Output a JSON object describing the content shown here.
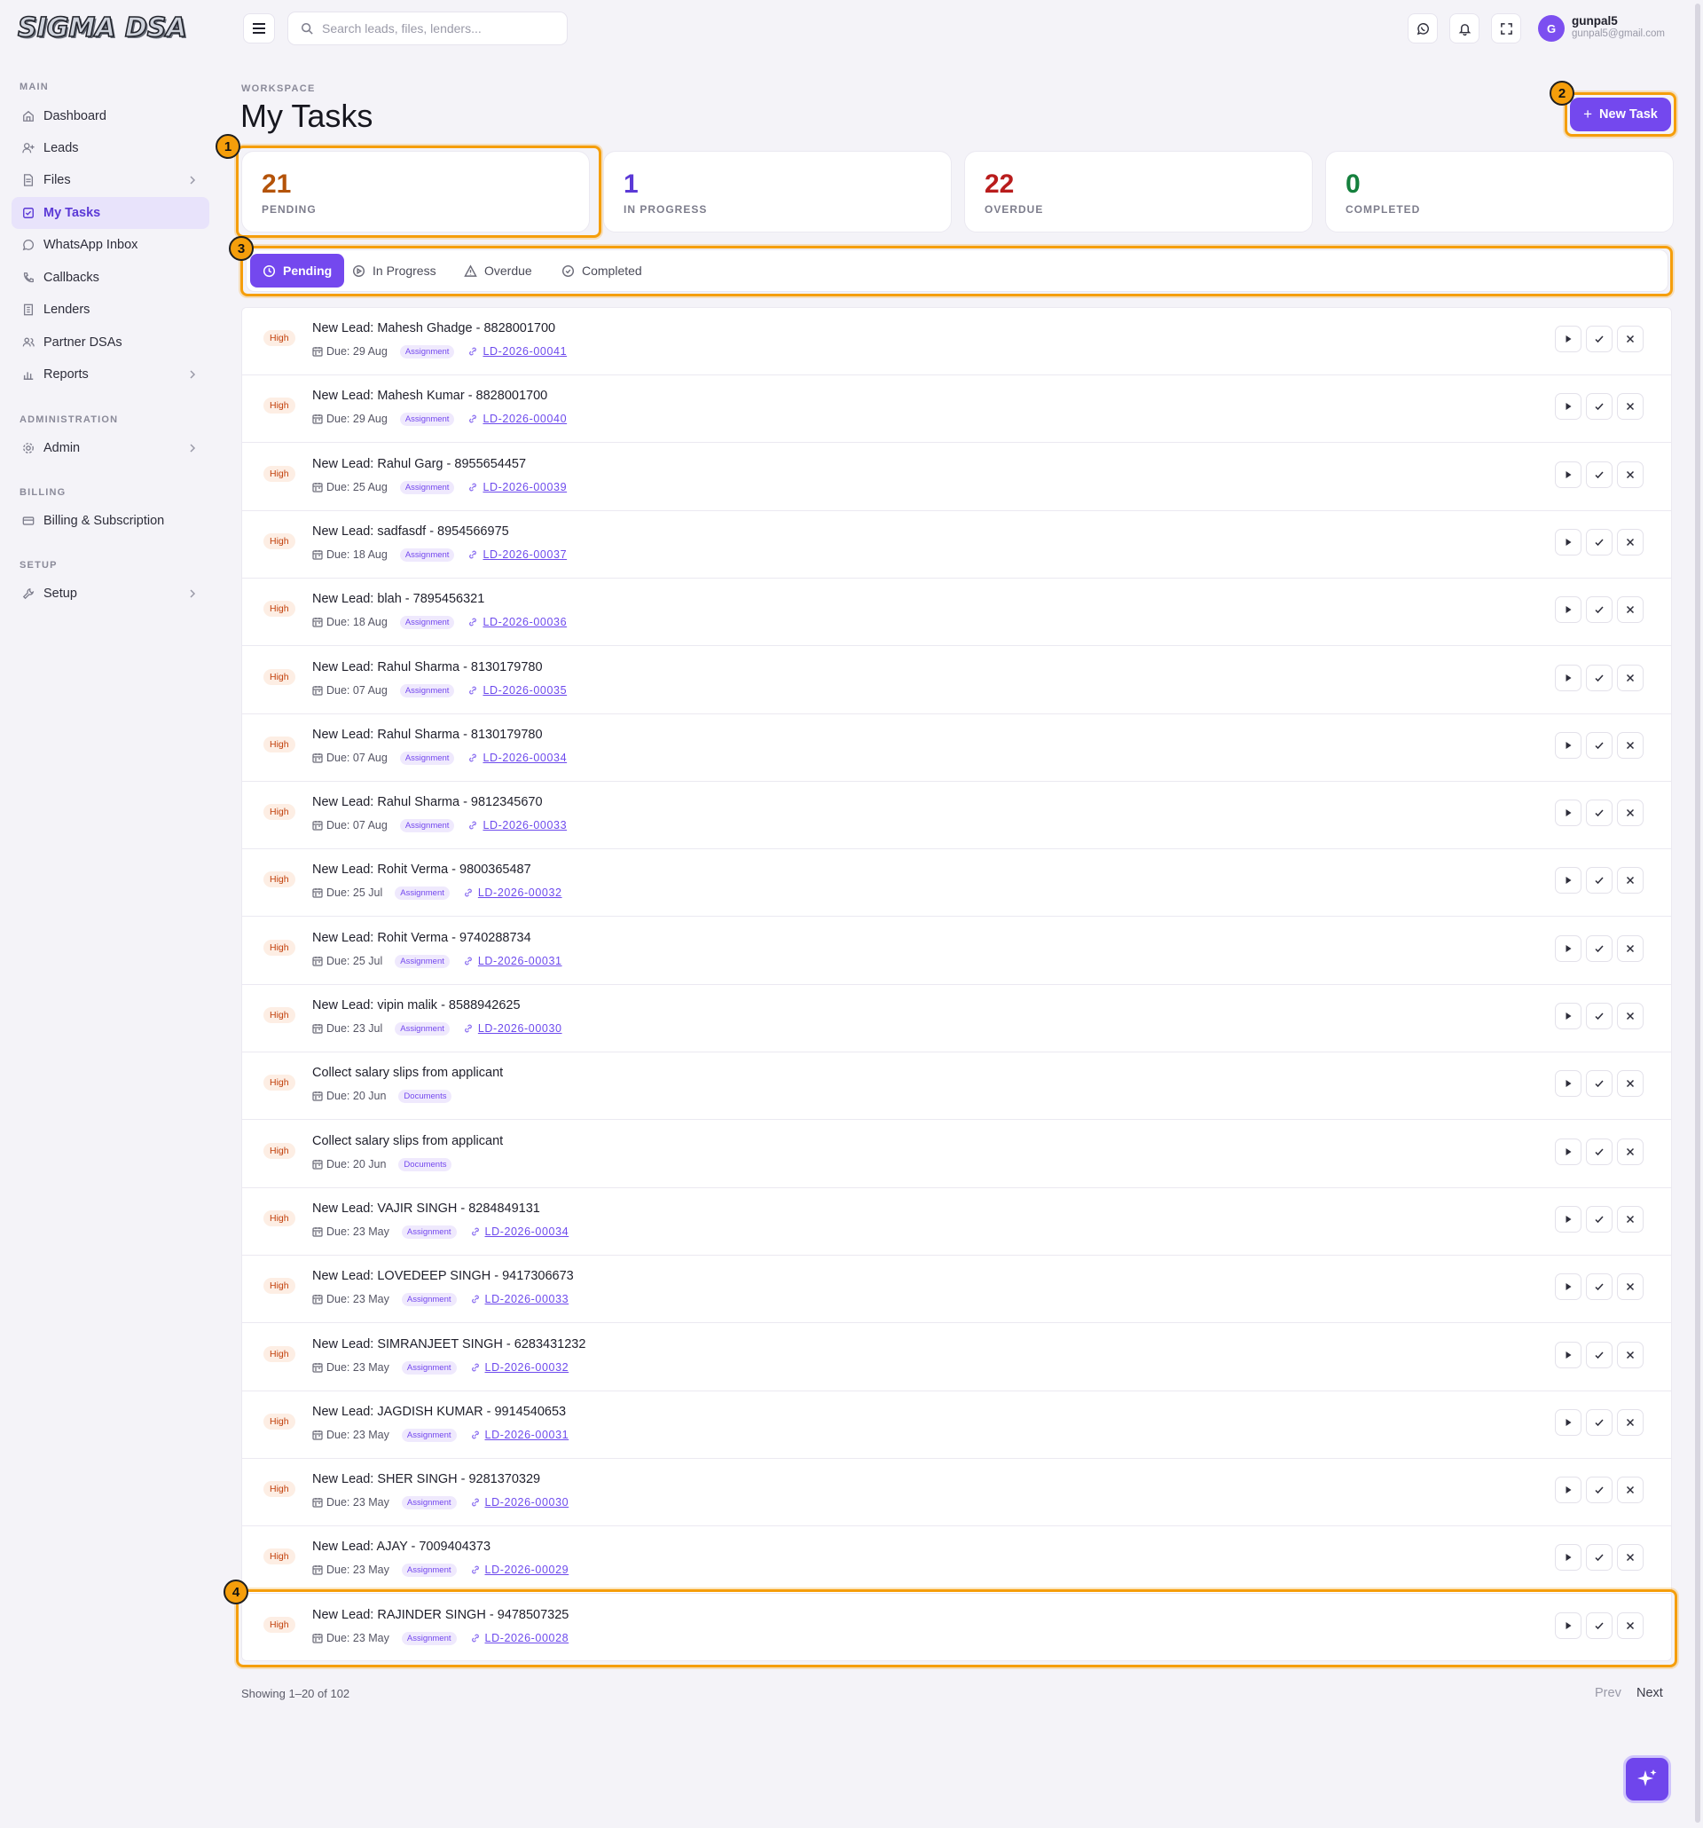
{
  "brand": {
    "logo_text": "SIGMA DSA"
  },
  "sidebar": {
    "sections": [
      {
        "label": "MAIN"
      },
      {
        "label": "ADMINISTRATION"
      },
      {
        "label": "BILLING"
      },
      {
        "label": "SETUP"
      }
    ],
    "items": [
      {
        "label": "Dashboard",
        "icon": "home-icon"
      },
      {
        "label": "Leads",
        "icon": "user-plus-icon"
      },
      {
        "label": "Files",
        "icon": "file-icon"
      },
      {
        "label": "My Tasks",
        "icon": "task-icon"
      },
      {
        "label": "WhatsApp Inbox",
        "icon": "whatsapp-icon"
      },
      {
        "label": "Callbacks",
        "icon": "phone-icon"
      },
      {
        "label": "Lenders",
        "icon": "building-icon"
      },
      {
        "label": "Partner DSAs",
        "icon": "users-icon"
      },
      {
        "label": "Reports",
        "icon": "bar-chart-icon"
      },
      {
        "label": "Admin",
        "icon": "gear-icon"
      },
      {
        "label": "Billing & Subscription",
        "icon": "credit-card-icon"
      },
      {
        "label": "Setup",
        "icon": "wrench-icon"
      }
    ]
  },
  "topbar": {
    "search_placeholder": "Search leads, files, lenders...",
    "user": {
      "initial": "G",
      "name": "gunpal5",
      "email": "gunpal5@gmail.com"
    }
  },
  "page": {
    "eyebrow": "WORKSPACE",
    "title": "My Tasks",
    "new_task_label": "New Task"
  },
  "stats": [
    {
      "value": "21",
      "label": "PENDING",
      "color": "#b45309"
    },
    {
      "value": "1",
      "label": "IN PROGRESS",
      "color": "#5b39d6"
    },
    {
      "value": "22",
      "label": "OVERDUE",
      "color": "#b91c1c"
    },
    {
      "value": "0",
      "label": "COMPLETED",
      "color": "#15803d"
    }
  ],
  "tabs": [
    {
      "label": "Pending",
      "active": true
    },
    {
      "label": "In Progress"
    },
    {
      "label": "Overdue"
    },
    {
      "label": "Completed"
    }
  ],
  "tasks": [
    {
      "priority": "High",
      "title": "New Lead: Mahesh Ghadge - 8828001700",
      "due": "Due: 29 Aug",
      "tag": "Assignment",
      "lead": "LD-2026-00041"
    },
    {
      "priority": "High",
      "title": "New Lead: Mahesh Kumar - 8828001700",
      "due": "Due: 29 Aug",
      "tag": "Assignment",
      "lead": "LD-2026-00040"
    },
    {
      "priority": "High",
      "title": "New Lead: Rahul Garg - 8955654457",
      "due": "Due: 25 Aug",
      "tag": "Assignment",
      "lead": "LD-2026-00039"
    },
    {
      "priority": "High",
      "title": "New Lead: sadfasdf - 8954566975",
      "due": "Due: 18 Aug",
      "tag": "Assignment",
      "lead": "LD-2026-00037"
    },
    {
      "priority": "High",
      "title": "New Lead: blah - 7895456321",
      "due": "Due: 18 Aug",
      "tag": "Assignment",
      "lead": "LD-2026-00036"
    },
    {
      "priority": "High",
      "title": "New Lead: Rahul Sharma - 8130179780",
      "due": "Due: 07 Aug",
      "tag": "Assignment",
      "lead": "LD-2026-00035"
    },
    {
      "priority": "High",
      "title": "New Lead: Rahul Sharma - 8130179780",
      "due": "Due: 07 Aug",
      "tag": "Assignment",
      "lead": "LD-2026-00034"
    },
    {
      "priority": "High",
      "title": "New Lead: Rahul Sharma - 9812345670",
      "due": "Due: 07 Aug",
      "tag": "Assignment",
      "lead": "LD-2026-00033"
    },
    {
      "priority": "High",
      "title": "New Lead: Rohit Verma - 9800365487",
      "due": "Due: 25 Jul",
      "tag": "Assignment",
      "lead": "LD-2026-00032"
    },
    {
      "priority": "High",
      "title": "New Lead: Rohit Verma - 9740288734",
      "due": "Due: 25 Jul",
      "tag": "Assignment",
      "lead": "LD-2026-00031"
    },
    {
      "priority": "High",
      "title": "New Lead: vipin malik - 8588942625",
      "due": "Due: 23 Jul",
      "tag": "Assignment",
      "lead": "LD-2026-00030"
    },
    {
      "priority": "High",
      "title": "Collect salary slips from applicant",
      "due": "Due: 20 Jun",
      "tag": "Documents",
      "lead": ""
    },
    {
      "priority": "High",
      "title": "Collect salary slips from applicant",
      "due": "Due: 20 Jun",
      "tag": "Documents",
      "lead": ""
    },
    {
      "priority": "High",
      "title": "New Lead: VAJIR SINGH - 8284849131",
      "due": "Due: 23 May",
      "tag": "Assignment",
      "lead": "LD-2026-00034"
    },
    {
      "priority": "High",
      "title": "New Lead: LOVEDEEP SINGH - 9417306673",
      "due": "Due: 23 May",
      "tag": "Assignment",
      "lead": "LD-2026-00033"
    },
    {
      "priority": "High",
      "title": "New Lead: SIMRANJEET SINGH - 6283431232",
      "due": "Due: 23 May",
      "tag": "Assignment",
      "lead": "LD-2026-00032"
    },
    {
      "priority": "High",
      "title": "New Lead: JAGDISH KUMAR - 9914540653",
      "due": "Due: 23 May",
      "tag": "Assignment",
      "lead": "LD-2026-00031"
    },
    {
      "priority": "High",
      "title": "New Lead: SHER SINGH - 9281370329",
      "due": "Due: 23 May",
      "tag": "Assignment",
      "lead": "LD-2026-00030"
    },
    {
      "priority": "High",
      "title": "New Lead: AJAY - 7009404373",
      "due": "Due: 23 May",
      "tag": "Assignment",
      "lead": "LD-2026-00029"
    },
    {
      "priority": "High",
      "title": "New Lead: RAJINDER SINGH - 9478507325",
      "due": "Due: 23 May",
      "tag": "Assignment",
      "lead": "LD-2026-00028"
    }
  ],
  "pagination": {
    "showing": "Showing 1–20 of 102",
    "prev": "Prev",
    "next": "Next"
  },
  "annotations": [
    {
      "label": "1"
    },
    {
      "label": "2"
    },
    {
      "label": "3"
    },
    {
      "label": "4"
    }
  ],
  "colors": {
    "accent": "#7448ee",
    "highlight": "#f59e0b",
    "priority_bg": "#fdeee4",
    "priority_text": "#c2410c"
  }
}
